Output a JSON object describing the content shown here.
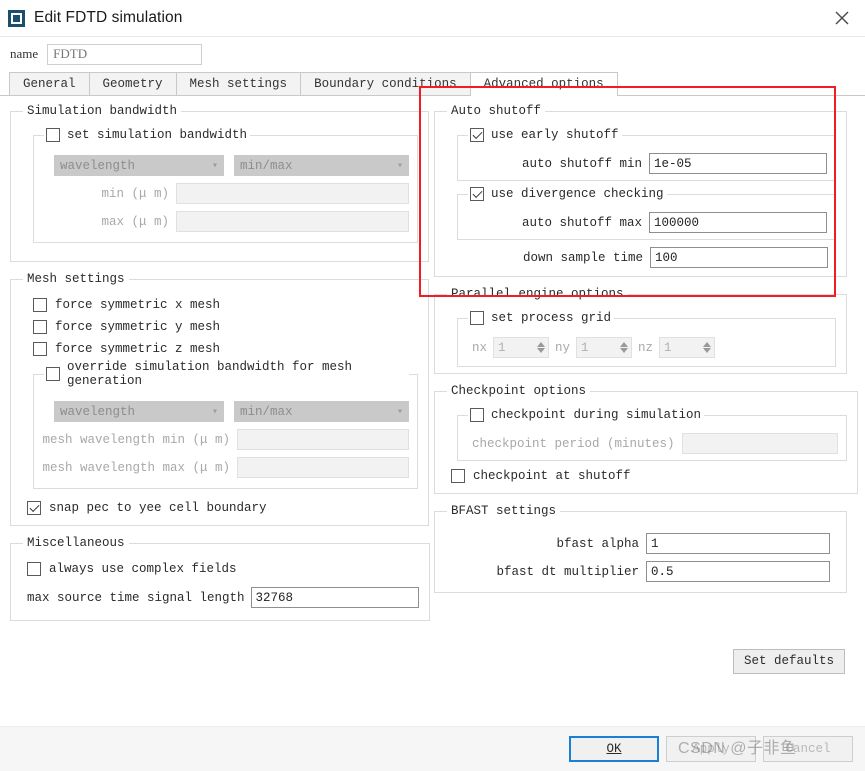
{
  "window": {
    "title": "Edit FDTD simulation",
    "icon": "app-window-icon",
    "close_icon": "close-icon"
  },
  "name_field": {
    "label": "name",
    "value": "FDTD",
    "placeholder": "FDTD"
  },
  "tabs": [
    {
      "label": "General",
      "active": false
    },
    {
      "label": "Geometry",
      "active": false
    },
    {
      "label": "Mesh settings",
      "active": false
    },
    {
      "label": "Boundary conditions",
      "active": false
    },
    {
      "label": "Advanced options",
      "active": true
    }
  ],
  "left": {
    "simulation_bandwidth": {
      "legend": "Simulation bandwidth",
      "set_simulation_bandwidth": {
        "label": "set simulation bandwidth",
        "checked": false
      },
      "combo_quantity": {
        "value": "wavelength",
        "chevron": "chevron-down-icon"
      },
      "combo_range": {
        "value": "min/max",
        "chevron": "chevron-down-icon"
      },
      "min": {
        "label": "min  (μ m)",
        "value": ""
      },
      "max": {
        "label": "max  (μ m)",
        "value": ""
      }
    },
    "mesh_settings": {
      "legend": "Mesh settings",
      "force_symmetric_x": {
        "label": "force symmetric x mesh",
        "checked": false
      },
      "force_symmetric_y": {
        "label": "force symmetric y mesh",
        "checked": false
      },
      "force_symmetric_z": {
        "label": "force symmetric z mesh",
        "checked": false
      },
      "override": {
        "label": "override simulation bandwidth for mesh generation",
        "checked": false
      },
      "combo_quantity": {
        "value": "wavelength",
        "chevron": "chevron-down-icon"
      },
      "combo_range": {
        "value": "min/max",
        "chevron": "chevron-down-icon"
      },
      "mesh_wavelength_min": {
        "label": "mesh wavelength min  (μ m)",
        "value": ""
      },
      "mesh_wavelength_max": {
        "label": "mesh wavelength max  (μ m)",
        "value": ""
      },
      "snap_pec": {
        "label": "snap pec to yee cell boundary",
        "checked": true
      }
    },
    "miscellaneous": {
      "legend": "Miscellaneous",
      "always_complex": {
        "label": "always use complex fields",
        "checked": false
      },
      "max_source_time_signal_length": {
        "label": "max source time signal length",
        "value": "32768"
      }
    }
  },
  "right": {
    "auto_shutoff": {
      "legend": "Auto shutoff",
      "highlighted": true,
      "use_early_shutoff": {
        "label": "use early shutoff",
        "checked": true
      },
      "auto_shutoff_min": {
        "label": "auto shutoff min",
        "value": "1e-05"
      },
      "use_divergence_checking": {
        "label": "use divergence checking",
        "checked": true
      },
      "auto_shutoff_max": {
        "label": "auto shutoff max",
        "value": "100000"
      },
      "down_sample_time": {
        "label": "down sample time",
        "value": "100"
      }
    },
    "parallel_engine": {
      "legend": "Parallel engine options",
      "set_process_grid": {
        "label": "set process grid",
        "checked": false
      },
      "nx": {
        "label": "nx",
        "value": "1"
      },
      "ny": {
        "label": "ny",
        "value": "1"
      },
      "nz": {
        "label": "nz",
        "value": "1"
      }
    },
    "checkpoint": {
      "legend": "Checkpoint options",
      "checkpoint_during_simulation": {
        "label": "checkpoint during simulation",
        "checked": false
      },
      "checkpoint_period": {
        "label": "checkpoint period (minutes)",
        "value": ""
      },
      "checkpoint_at_shutoff": {
        "label": "checkpoint at shutoff",
        "checked": false
      }
    },
    "bfast": {
      "legend": "BFAST settings",
      "bfast_alpha": {
        "label": "bfast alpha",
        "value": "1"
      },
      "bfast_dt_multiplier": {
        "label": "bfast dt multiplier",
        "value": "0.5"
      }
    },
    "set_defaults_label": "Set defaults"
  },
  "footer": {
    "ok": "OK",
    "apply": "Apply",
    "cancel": "Cancel"
  },
  "watermark": "CSDN @子非鱼",
  "colors": {
    "accent": "#1b7fd4",
    "highlight": "#f01e23",
    "titlebar_icon": "#1c4f6e"
  }
}
